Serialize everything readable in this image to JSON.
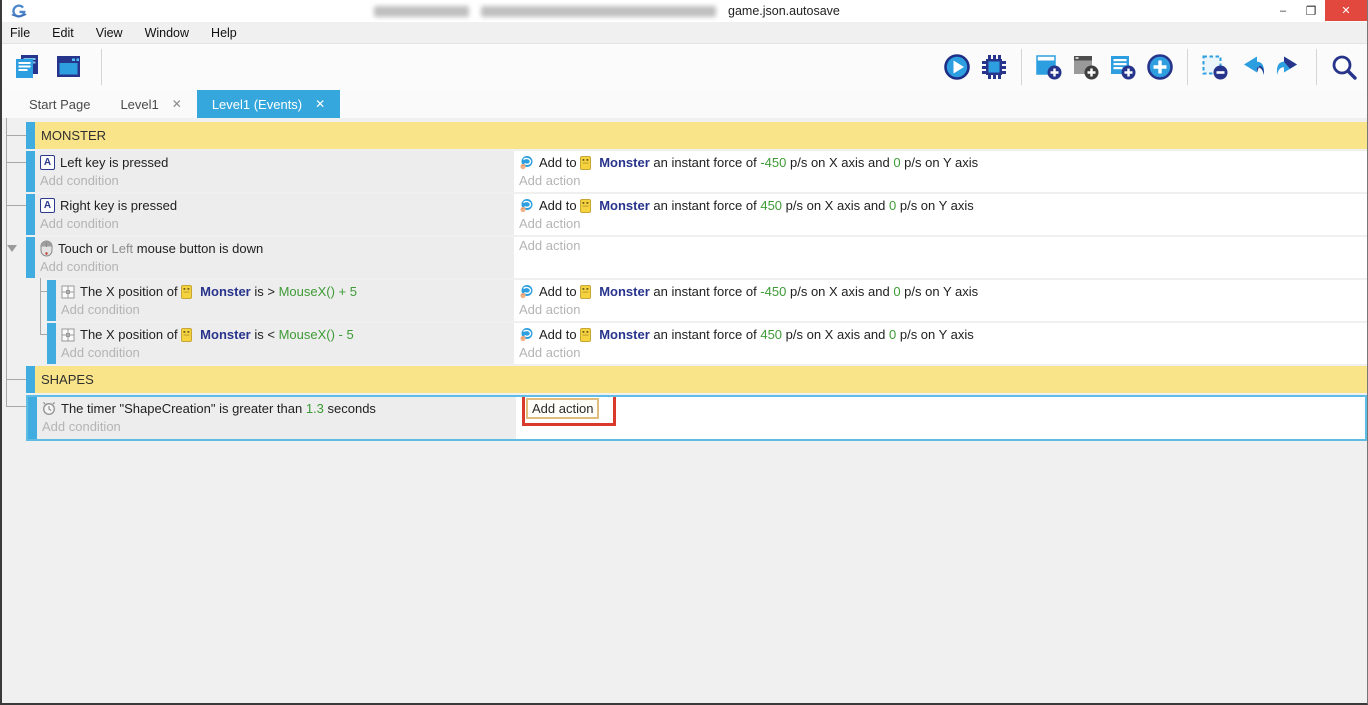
{
  "window": {
    "title": "game.json.autosave",
    "controls": {
      "minimize": "–",
      "maximize": "❐",
      "close": "✕"
    }
  },
  "menu_items": [
    "File",
    "Edit",
    "View",
    "Window",
    "Help"
  ],
  "toolbar": {
    "left_icons": [
      "project-manager-icon",
      "scene-editor-icon"
    ],
    "right_icons": [
      "play-icon",
      "debug-icon",
      "add-event-icon",
      "add-subevent-icon",
      "add-comment-icon",
      "add-circle-icon",
      "remove-event-icon",
      "undo-icon",
      "redo-icon",
      "search-icon"
    ]
  },
  "tabs": [
    {
      "label": "Start Page",
      "active": false,
      "closable": false,
      "close": ""
    },
    {
      "label": "Level1",
      "active": false,
      "closable": true,
      "close": "✕"
    },
    {
      "label": "Level1 (Events)",
      "active": true,
      "closable": true,
      "close": "✕"
    }
  ],
  "colors": {
    "accent_blue": "#35A7DC",
    "group_yellow": "#F9E48A",
    "event_bar_blue": "#41ACE0",
    "value_green": "#3D9B35",
    "object_navy": "#28348C",
    "selection_border": "#5FBCE4",
    "annotation_red": "#D93A2B",
    "close_button_red": "#E2483D"
  },
  "events": [
    {
      "kind": "group",
      "indent": 0,
      "label": "MONSTER"
    },
    {
      "kind": "event",
      "indent": 0,
      "conditions": [
        {
          "icon": "keyboard-icon",
          "segments": [
            {
              "text": "Left key is pressed",
              "style": "plain"
            }
          ]
        }
      ],
      "conditions_placeholder": "Add condition",
      "actions": [
        {
          "icon": "force-icon",
          "segments": [
            {
              "text": "Add to ",
              "style": "plain"
            },
            {
              "text": "Monster",
              "style": "object",
              "icon": "monster-icon"
            },
            {
              "text": " an instant force of ",
              "style": "plain"
            },
            {
              "text": "-450",
              "style": "value"
            },
            {
              "text": " p/s on X axis and ",
              "style": "plain"
            },
            {
              "text": "0",
              "style": "value"
            },
            {
              "text": " p/s on Y axis",
              "style": "plain"
            }
          ]
        }
      ],
      "actions_placeholder": "Add action"
    },
    {
      "kind": "event",
      "indent": 0,
      "conditions": [
        {
          "icon": "keyboard-icon",
          "segments": [
            {
              "text": "Right key is pressed",
              "style": "plain"
            }
          ]
        }
      ],
      "conditions_placeholder": "Add condition",
      "actions": [
        {
          "icon": "force-icon",
          "segments": [
            {
              "text": "Add to ",
              "style": "plain"
            },
            {
              "text": "Monster",
              "style": "object",
              "icon": "monster-icon"
            },
            {
              "text": " an instant force of ",
              "style": "plain"
            },
            {
              "text": "450",
              "style": "value"
            },
            {
              "text": " p/s on X axis and ",
              "style": "plain"
            },
            {
              "text": "0",
              "style": "value"
            },
            {
              "text": " p/s on Y axis",
              "style": "plain"
            }
          ]
        }
      ],
      "actions_placeholder": "Add action"
    },
    {
      "kind": "event",
      "indent": 0,
      "has_children": true,
      "conditions": [
        {
          "icon": "mouse-icon",
          "segments": [
            {
              "text": "Touch or ",
              "style": "plain"
            },
            {
              "text": "Left",
              "style": "param"
            },
            {
              "text": " mouse button is down",
              "style": "plain"
            }
          ]
        }
      ],
      "conditions_placeholder": "Add condition",
      "actions": [],
      "actions_placeholder": "Add action"
    },
    {
      "kind": "event",
      "indent": 1,
      "conditions": [
        {
          "icon": "position-icon",
          "segments": [
            {
              "text": "The X position of ",
              "style": "plain"
            },
            {
              "text": "Monster",
              "style": "object",
              "icon": "monster-icon"
            },
            {
              "text": " is > ",
              "style": "plain"
            },
            {
              "text": "MouseX() + 5",
              "style": "value"
            }
          ]
        }
      ],
      "conditions_placeholder": "Add condition",
      "actions": [
        {
          "icon": "force-icon",
          "segments": [
            {
              "text": "Add to ",
              "style": "plain"
            },
            {
              "text": "Monster",
              "style": "object",
              "icon": "monster-icon"
            },
            {
              "text": " an instant force of ",
              "style": "plain"
            },
            {
              "text": "-450",
              "style": "value"
            },
            {
              "text": " p/s on X axis and ",
              "style": "plain"
            },
            {
              "text": "0",
              "style": "value"
            },
            {
              "text": " p/s on Y axis",
              "style": "plain"
            }
          ]
        }
      ],
      "actions_placeholder": "Add action"
    },
    {
      "kind": "event",
      "indent": 1,
      "conditions": [
        {
          "icon": "position-icon",
          "segments": [
            {
              "text": "The X position of ",
              "style": "plain"
            },
            {
              "text": "Monster",
              "style": "object",
              "icon": "monster-icon"
            },
            {
              "text": " is < ",
              "style": "plain"
            },
            {
              "text": "MouseX() - 5",
              "style": "value"
            }
          ]
        }
      ],
      "conditions_placeholder": "Add condition",
      "actions": [
        {
          "icon": "force-icon",
          "segments": [
            {
              "text": "Add to ",
              "style": "plain"
            },
            {
              "text": "Monster",
              "style": "object",
              "icon": "monster-icon"
            },
            {
              "text": " an instant force of ",
              "style": "plain"
            },
            {
              "text": "450",
              "style": "value"
            },
            {
              "text": " p/s on X axis and ",
              "style": "plain"
            },
            {
              "text": "0",
              "style": "value"
            },
            {
              "text": " p/s on Y axis",
              "style": "plain"
            }
          ]
        }
      ],
      "actions_placeholder": "Add action"
    },
    {
      "kind": "group",
      "indent": 0,
      "label": "SHAPES"
    },
    {
      "kind": "event",
      "indent": 0,
      "selected": true,
      "annotated": true,
      "conditions": [
        {
          "icon": "timer-icon",
          "segments": [
            {
              "text": "The timer \"ShapeCreation\" is greater than ",
              "style": "plain"
            },
            {
              "text": "1.3",
              "style": "value"
            },
            {
              "text": " seconds",
              "style": "plain"
            }
          ]
        }
      ],
      "conditions_placeholder": "Add condition",
      "actions": [],
      "actions_placeholder": "Add action"
    }
  ]
}
